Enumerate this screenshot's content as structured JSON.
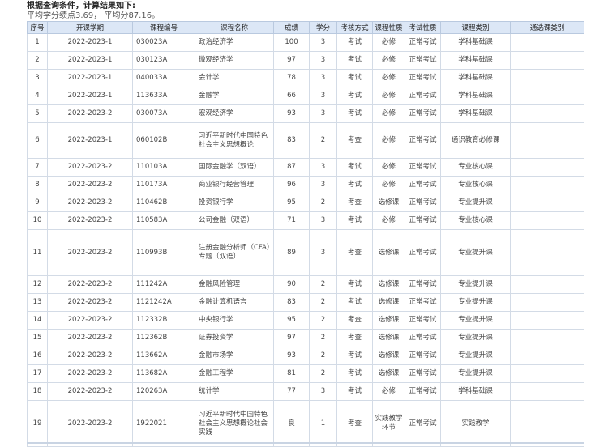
{
  "header": {
    "title": "根据查询条件，计算结果如下:",
    "summary": "平均学分绩点3.69，  平均分87.16。"
  },
  "table": {
    "columns": [
      "序号",
      "开课学期",
      "课程编号",
      "课程名称",
      "成绩",
      "学分",
      "考核方式",
      "课程性质",
      "考试性质",
      "课程类别",
      "通选课类别"
    ],
    "rows": [
      [
        "1",
        "2022-2023-1",
        "030023A",
        "政治经济学",
        "100",
        "3",
        "考试",
        "必修",
        "正常考试",
        "学科基础课",
        ""
      ],
      [
        "2",
        "2022-2023-1",
        "030123A",
        "微观经济学",
        "97",
        "3",
        "考试",
        "必修",
        "正常考试",
        "学科基础课",
        ""
      ],
      [
        "3",
        "2022-2023-1",
        "040033A",
        "会计学",
        "78",
        "3",
        "考试",
        "必修",
        "正常考试",
        "学科基础课",
        ""
      ],
      [
        "4",
        "2022-2023-1",
        "113633A",
        "金融学",
        "66",
        "3",
        "考试",
        "必修",
        "正常考试",
        "学科基础课",
        ""
      ],
      [
        "5",
        "2022-2023-2",
        "030073A",
        "宏观经济学",
        "93",
        "3",
        "考试",
        "必修",
        "正常考试",
        "学科基础课",
        ""
      ],
      [
        "6",
        "2022-2023-1",
        "060102B",
        "习近平新时代中国特色社会主义思想概论",
        "83",
        "2",
        "考查",
        "必修",
        "正常考试",
        "通识教育必修课",
        ""
      ],
      [
        "7",
        "2022-2023-2",
        "110103A",
        "国际金融学（双语）",
        "87",
        "3",
        "考试",
        "必修",
        "正常考试",
        "专业核心课",
        ""
      ],
      [
        "8",
        "2022-2023-2",
        "110173A",
        "商业银行经营管理",
        "96",
        "3",
        "考试",
        "必修",
        "正常考试",
        "专业核心课",
        ""
      ],
      [
        "9",
        "2022-2023-2",
        "110462B",
        "投资银行学",
        "95",
        "2",
        "考查",
        "选修课",
        "正常考试",
        "专业提升课",
        ""
      ],
      [
        "10",
        "2022-2023-2",
        "110583A",
        "公司金融（双语）",
        "71",
        "3",
        "考试",
        "必修",
        "正常考试",
        "专业核心课",
        ""
      ],
      [
        "11",
        "2022-2023-2",
        "110993B",
        "注册金融分析师（CFA）专题（双语）",
        "89",
        "3",
        "考查",
        "选修课",
        "正常考试",
        "专业提升课",
        ""
      ],
      [
        "12",
        "2022-2023-2",
        "111242A",
        "金融风险管理",
        "90",
        "2",
        "考试",
        "选修课",
        "正常考试",
        "专业提升课",
        ""
      ],
      [
        "13",
        "2022-2023-2",
        "1121242A",
        "金融计算机语言",
        "83",
        "2",
        "考试",
        "选修课",
        "正常考试",
        "专业提升课",
        ""
      ],
      [
        "14",
        "2022-2023-2",
        "112332B",
        "中央银行学",
        "95",
        "2",
        "考查",
        "选修课",
        "正常考试",
        "专业提升课",
        ""
      ],
      [
        "15",
        "2022-2023-2",
        "112362B",
        "证券投资学",
        "97",
        "2",
        "考查",
        "选修课",
        "正常考试",
        "专业提升课",
        ""
      ],
      [
        "16",
        "2022-2023-2",
        "113662A",
        "金融市场学",
        "93",
        "2",
        "考试",
        "选修课",
        "正常考试",
        "专业提升课",
        ""
      ],
      [
        "17",
        "2022-2023-2",
        "113682A",
        "金融工程学",
        "81",
        "2",
        "考试",
        "选修课",
        "正常考试",
        "专业提升课",
        ""
      ],
      [
        "18",
        "2022-2023-2",
        "120263A",
        "统计学",
        "77",
        "3",
        "考试",
        "必修",
        "正常考试",
        "学科基础课",
        ""
      ],
      [
        "19",
        "2022-2023-2",
        "1922021",
        "习近平新时代中国特色社会主义思想概论社会实践",
        "良",
        "1",
        "考查",
        "实践教学环节",
        "正常考试",
        "实践教学",
        ""
      ]
    ]
  }
}
